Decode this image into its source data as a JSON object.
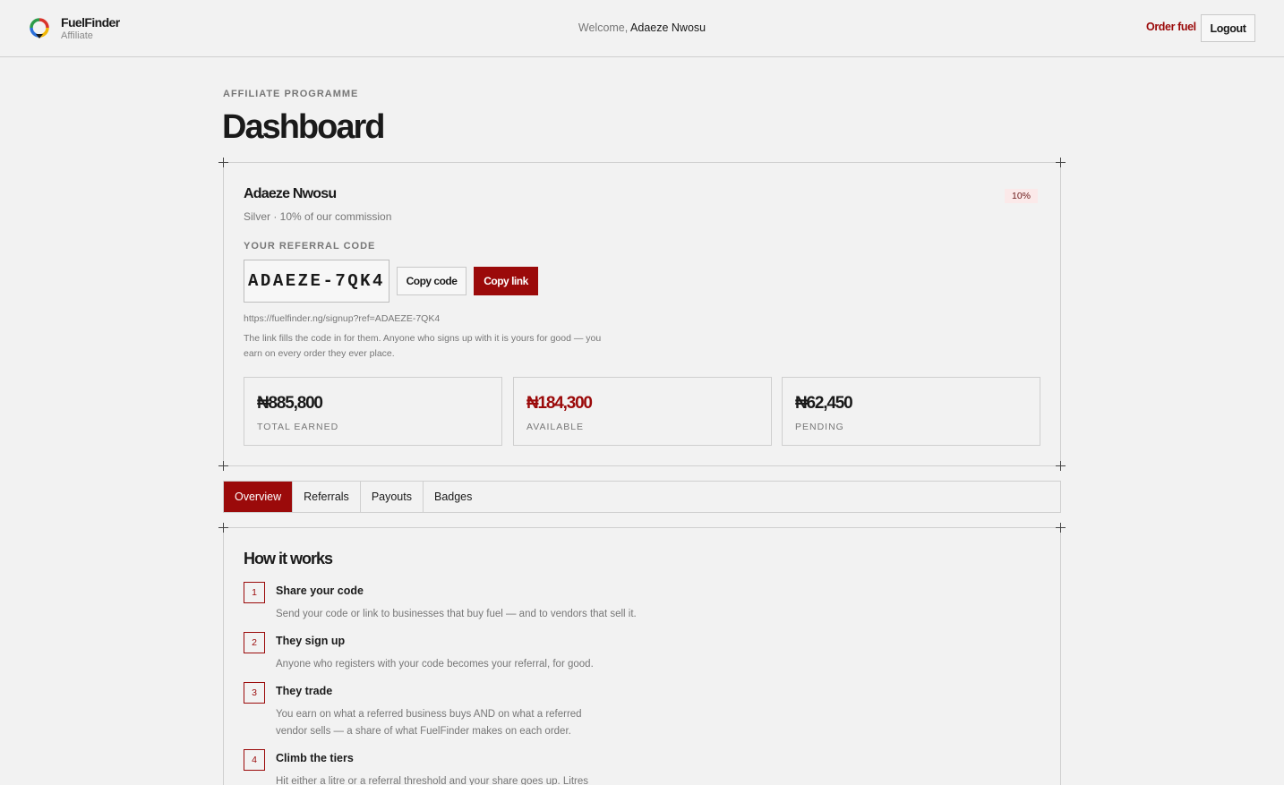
{
  "header": {
    "brand_name": "FuelFinder",
    "brand_sub": "Affiliate",
    "welcome_prefix": "Welcome,",
    "welcome_user": "Adaeze Nwosu",
    "order_fuel": "Order fuel",
    "logout": "Logout"
  },
  "page": {
    "eyebrow": "AFFILIATE PROGRAMME",
    "title": "Dashboard"
  },
  "profile": {
    "name": "Adaeze Nwosu",
    "tier_line": "Silver · 10% of our commission",
    "rate_badge": "10%",
    "code_label": "YOUR REFERRAL CODE",
    "code": "ADAEZE-7QK4",
    "copy_code": "Copy code",
    "copy_link": "Copy link",
    "ref_url": "https://fuelfinder.ng/signup?ref=ADAEZE-7QK4",
    "note": "The link fills the code in for them. Anyone who signs up with it is yours for good — you earn on every order they ever place."
  },
  "stats": [
    {
      "value": "₦885,800",
      "label": "TOTAL EARNED"
    },
    {
      "value": "₦184,300",
      "label": "AVAILABLE"
    },
    {
      "value": "₦62,450",
      "label": "PENDING"
    }
  ],
  "tabs": [
    "Overview",
    "Referrals",
    "Payouts",
    "Badges"
  ],
  "active_tab": "Overview",
  "how": {
    "title": "How it works",
    "steps": [
      {
        "num": "1",
        "title": "Share your code",
        "desc": "Send your code or link to businesses that buy fuel — and to vendors that sell it."
      },
      {
        "num": "2",
        "title": "They sign up",
        "desc": "Anyone who registers with your code becomes your referral, for good."
      },
      {
        "num": "3",
        "title": "They trade",
        "desc": "You earn on what a referred business buys AND on what a referred vendor sells — a share of what FuelFinder makes on each order."
      },
      {
        "num": "4",
        "title": "Climb the tiers",
        "desc": "Hit either a litre or a referral threshold and your share goes up. Litres"
      }
    ]
  },
  "colors": {
    "accent": "#9b0a0a",
    "background": "#f2f2f2",
    "border": "#cfcfcf",
    "muted_text": "#777777",
    "badge_bg": "#fbe9e9"
  },
  "icons": {
    "brand": "fuelfinder-logo-icon",
    "corner": "crosshair-corner-icon"
  }
}
